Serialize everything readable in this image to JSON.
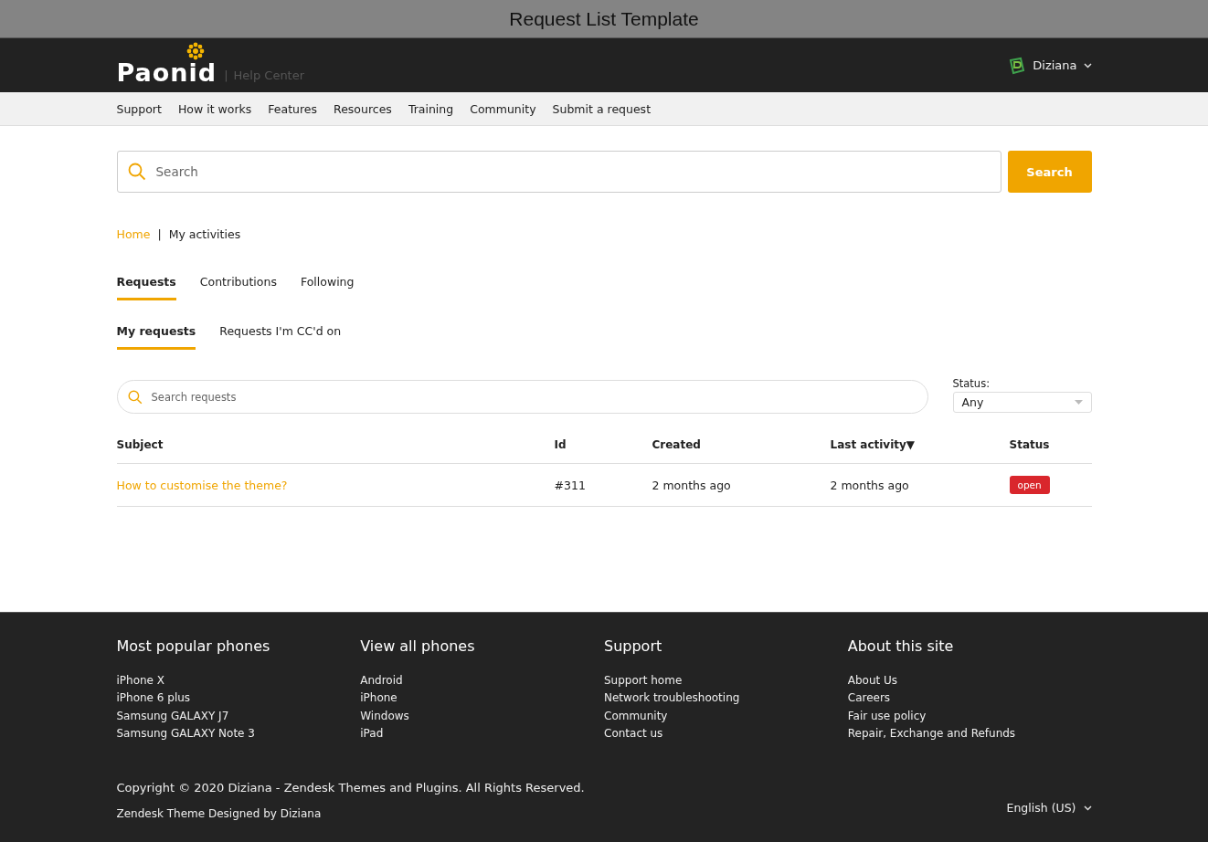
{
  "window": {
    "title": "Request List Template"
  },
  "header": {
    "logo": "Paonid",
    "divider": "|",
    "subtitle": "Help Center",
    "user": "Diziana"
  },
  "nav": {
    "items": [
      "Support",
      "How it works",
      "Features",
      "Resources",
      "Training",
      "Community",
      "Submit a request"
    ]
  },
  "search": {
    "placeholder": "Search",
    "button": "Search"
  },
  "breadcrumb": [
    {
      "label": "Home",
      "kind": "link"
    },
    {
      "label": "My activities",
      "kind": "current"
    }
  ],
  "separator": "|",
  "tabs": [
    {
      "label": "Requests",
      "selected": true
    },
    {
      "label": "Contributions",
      "selected": false
    },
    {
      "label": "Following",
      "selected": false
    }
  ],
  "subtabs": [
    {
      "label": "My requests",
      "selected": true
    },
    {
      "label": "Requests I'm CC'd on",
      "selected": false
    }
  ],
  "filter": {
    "placeholder": "Search requests",
    "status_label": "Status:",
    "status_value": "Any"
  },
  "table": {
    "columns": [
      {
        "label": "Subject"
      },
      {
        "label": "Id"
      },
      {
        "label": "Created"
      },
      {
        "label": "Last activity",
        "sort": "▼"
      },
      {
        "label": "Status"
      }
    ],
    "rows": [
      {
        "subject": "How to customise the theme?",
        "id": "#311",
        "created": "2 months ago",
        "last_activity": "2 months ago",
        "status": "open",
        "color": "#d9262c"
      }
    ]
  },
  "footer": {
    "columns": [
      {
        "title": "Most popular phones",
        "links": [
          "iPhone X",
          "iPhone 6 plus",
          "Samsung GALAXY J7",
          "Samsung GALAXY Note 3"
        ]
      },
      {
        "title": "View all phones",
        "links": [
          "Android",
          "iPhone",
          "Windows",
          "iPad"
        ]
      },
      {
        "title": "Support",
        "links": [
          "Support home",
          "Network troubleshooting",
          "Community",
          "Contact us"
        ]
      },
      {
        "title": "About this site",
        "links": [
          "About Us",
          "Careers",
          "Fair use policy",
          "Repair, Exchange and Refunds"
        ]
      }
    ],
    "copyright": "Copyright © 2020 Diziana - Zendesk Themes and Plugins. All Rights Reserved.",
    "credit": "Zendesk Theme Designed by Diziana",
    "language": "English (US)"
  }
}
